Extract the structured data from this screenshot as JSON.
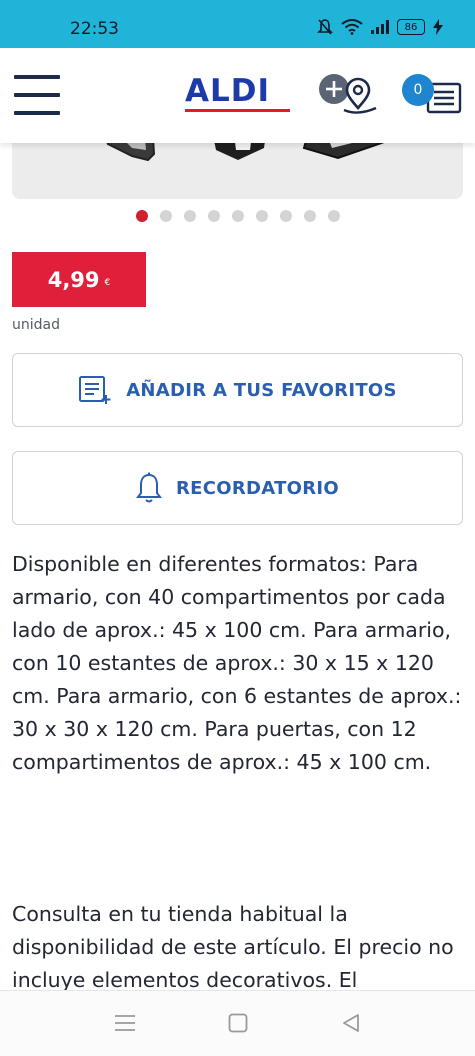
{
  "status_bar": {
    "time": "22:53",
    "battery": "86",
    "icons": [
      "mute-icon",
      "wifi-icon",
      "signal-icon",
      "battery-icon",
      "charging-icon"
    ]
  },
  "header": {
    "logo_text": "ALDI",
    "list_count": "0",
    "icons": [
      "menu-icon",
      "store-locator-icon",
      "shopping-list-icon"
    ]
  },
  "carousel": {
    "total_slides": 9,
    "active_index": 0
  },
  "product": {
    "price": "4,99",
    "currency": "€",
    "unit": "unidad"
  },
  "actions": {
    "favorites_label": "AÑADIR A TUS FAVORITOS",
    "reminder_label": "RECORDATORIO"
  },
  "description": {
    "paragraph_1": "Disponible en diferentes formatos: Para armario, con 40 compartimentos por cada lado de aprox.: 45 x 100 cm. Para armario, con 10 estantes de aprox.: 30 x 15 x 120 cm. Para armario, con 6 estantes de aprox.: 30 x 30 x 120 cm. Para puertas, con 12 compartimentos de aprox.: 45 x 100 cm.",
    "paragraph_2": "Consulta en tu tienda habitual la disponibilidad de este artículo. El precio no incluye elementos decorativos. El"
  },
  "colors": {
    "status_bar": "#20b4d8",
    "brand_blue": "#1c3aa8",
    "brand_red": "#e21b2c",
    "price_bg": "#e0203a",
    "action_text": "#2a5fb0",
    "badge": "#1e86d0"
  },
  "nav_bar": {
    "icons": [
      "recents-icon",
      "home-icon",
      "back-icon"
    ]
  }
}
